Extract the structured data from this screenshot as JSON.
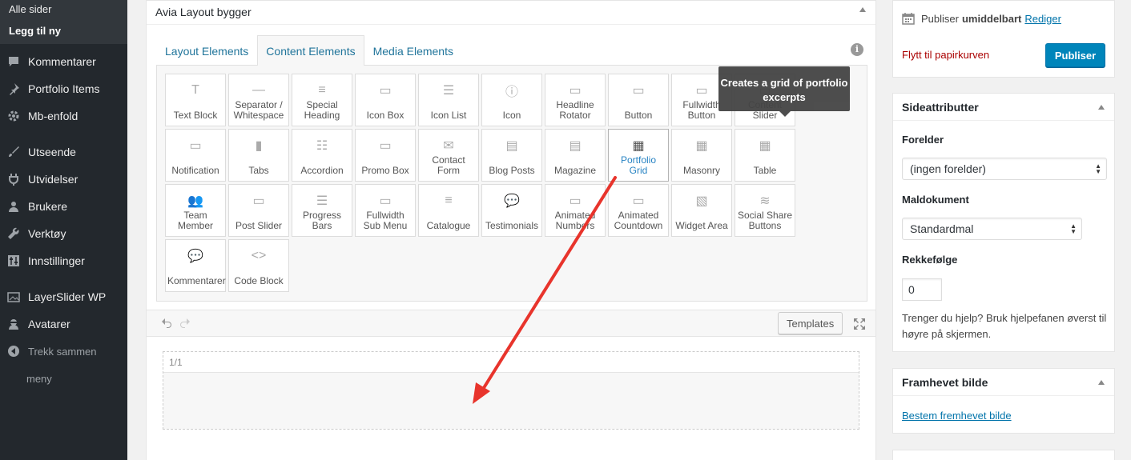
{
  "sidebar": {
    "submenu": [
      "Alle sider",
      "Legg til ny"
    ],
    "items": [
      {
        "label": "Kommentarer",
        "icon": "comment-icon"
      },
      {
        "label": "Portfolio Items",
        "icon": "pin-icon"
      },
      {
        "label": "Mb-enfold",
        "icon": "gear-icon"
      },
      {
        "label": "Utseende",
        "icon": "brush-icon"
      },
      {
        "label": "Utvidelser",
        "icon": "plugin-icon"
      },
      {
        "label": "Brukere",
        "icon": "user-icon"
      },
      {
        "label": "Verktøy",
        "icon": "wrench-icon"
      },
      {
        "label": "Innstillinger",
        "icon": "settings-icon"
      },
      {
        "label": "LayerSlider WP",
        "icon": "layers-icon"
      },
      {
        "label": "Avatarer",
        "icon": "avatar-icon"
      },
      {
        "label": "Trekk sammen",
        "icon": "collapse-icon"
      },
      {
        "label": "meny",
        "icon": ""
      }
    ]
  },
  "builder": {
    "title": "Avia Layout bygger",
    "tabs": [
      "Layout Elements",
      "Content Elements",
      "Media Elements"
    ],
    "active_tab": "Content Elements",
    "elements": [
      "Text Block",
      "Separator / Whitespace",
      "Special Heading",
      "Icon Box",
      "Icon List",
      "Icon",
      "Headline Rotator",
      "Button",
      "Fullwidth Button",
      "Content Slider",
      "Notification",
      "Tabs",
      "Accordion",
      "Promo Box",
      "Contact Form",
      "Blog Posts",
      "Magazine",
      "Portfolio Grid",
      "Masonry",
      "Table",
      "Team Member",
      "Post Slider",
      "Progress Bars",
      "Fullwidth Sub Menu",
      "Catalogue",
      "Testimonials",
      "Animated Numbers",
      "Animated Countdown",
      "Widget Area",
      "Social Share Buttons",
      "Kommentarer",
      "Code Block"
    ],
    "hovered_element": "Portfolio Grid",
    "tooltip": "Creates a grid of portfolio excerpts",
    "templates_label": "Templates",
    "section_label": "1/1"
  },
  "publish": {
    "status_prefix": "Publiser",
    "status_value": "umiddelbart",
    "edit_link": "Rediger",
    "trash_link": "Flytt til papirkurven",
    "publish_button": "Publiser"
  },
  "attributes": {
    "title": "Sideattributter",
    "parent_label": "Forelder",
    "parent_value": "(ingen forelder)",
    "template_label": "Maldokument",
    "template_value": "Standardmal",
    "order_label": "Rekkefølge",
    "order_value": "0",
    "help_text": "Trenger du hjelp? Bruk hjelpefanen øverst til høyre på skjermen."
  },
  "featured": {
    "title": "Framhevet bilde",
    "link": "Bestem fremhevet bilde"
  },
  "colors": {
    "admin_bg": "#23282d",
    "link": "#0073aa",
    "primary_button": "#0085ba",
    "trash": "#a00",
    "annotation_arrow": "#e8342c"
  }
}
